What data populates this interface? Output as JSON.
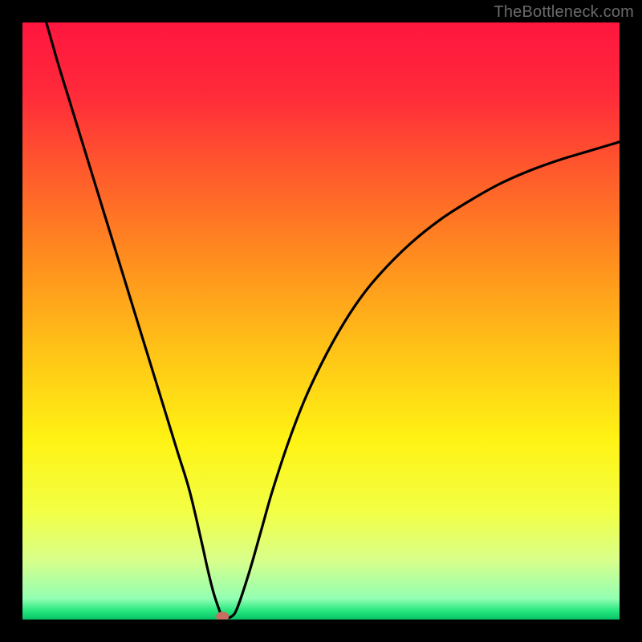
{
  "watermark": "TheBottleneck.com",
  "chart_data": {
    "type": "line",
    "title": "",
    "xlabel": "",
    "ylabel": "",
    "xlim": [
      0,
      100
    ],
    "ylim": [
      0,
      100
    ],
    "grid": false,
    "legend": false,
    "gradient_stops": [
      {
        "offset": 0.0,
        "color": "#ff163f"
      },
      {
        "offset": 0.12,
        "color": "#ff2a3a"
      },
      {
        "offset": 0.25,
        "color": "#ff5a2c"
      },
      {
        "offset": 0.4,
        "color": "#ff8f1e"
      },
      {
        "offset": 0.55,
        "color": "#ffc317"
      },
      {
        "offset": 0.7,
        "color": "#fff314"
      },
      {
        "offset": 0.82,
        "color": "#f2ff45"
      },
      {
        "offset": 0.9,
        "color": "#d9ff8a"
      },
      {
        "offset": 0.965,
        "color": "#93ffb3"
      },
      {
        "offset": 0.985,
        "color": "#27e87e"
      },
      {
        "offset": 1.0,
        "color": "#06c166"
      }
    ],
    "marker": {
      "x": 33.5,
      "y": 0.5,
      "color": "#c76d63"
    },
    "series": [
      {
        "name": "curve",
        "x": [
          4,
          6,
          8,
          10,
          12,
          14,
          16,
          18,
          20,
          22,
          24,
          26,
          28,
          30,
          31,
          32,
          33,
          33.5,
          34,
          35,
          36,
          38,
          40,
          42,
          45,
          48,
          52,
          56,
          60,
          65,
          70,
          75,
          80,
          85,
          90,
          95,
          100
        ],
        "y": [
          100,
          93,
          86.5,
          80,
          73.5,
          67,
          60.5,
          54,
          47.5,
          41,
          34.5,
          28,
          21.5,
          13,
          8.5,
          4.5,
          1.5,
          0.3,
          0.3,
          0.5,
          2,
          8,
          15,
          22,
          31,
          38.5,
          46.5,
          53,
          58,
          63,
          67,
          70.2,
          73,
          75.2,
          77,
          78.5,
          80
        ]
      }
    ]
  }
}
